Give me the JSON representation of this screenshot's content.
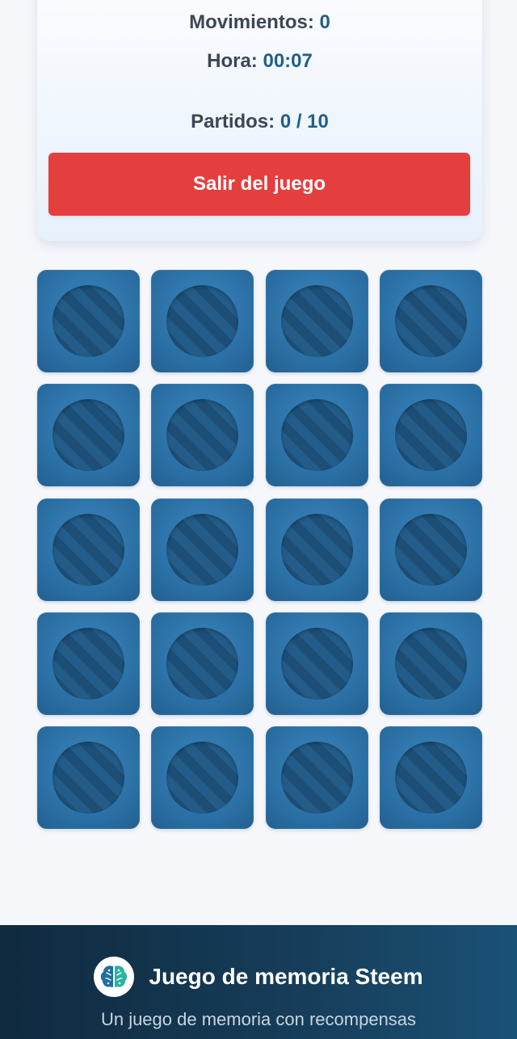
{
  "stats": {
    "moves_label": "Movimientos:",
    "moves_value": "0",
    "time_label": "Hora:",
    "time_value": "00:07",
    "matches_label": "Partidos:",
    "matches_value": "0 / 10",
    "exit_label": "Salir del juego"
  },
  "board": {
    "columns": 4,
    "rows": 5,
    "card_state": "face-down",
    "card_color": "#2a6fa4",
    "card_icon": "striped-circle-icon"
  },
  "footer": {
    "logo_icon": "brain-icon",
    "title": "Juego de memoria Steem",
    "tagline": "Un juego de memoria con recompensas"
  },
  "colors": {
    "accent_value": "#1f5f8a",
    "danger": "#e53e3e",
    "footer_bg": "#163c58"
  }
}
